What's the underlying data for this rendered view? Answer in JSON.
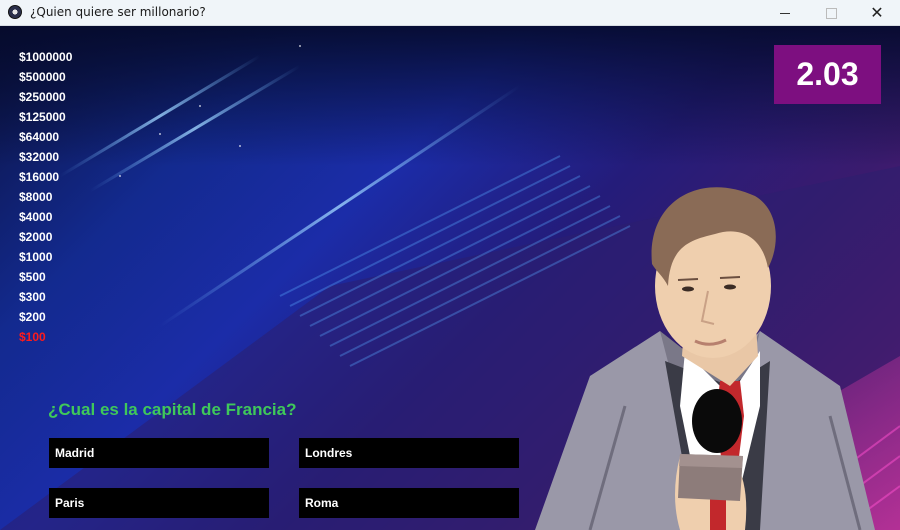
{
  "window": {
    "title": "¿Quien quiere ser millonario?",
    "minimize_icon": "minimize-icon",
    "maximize_icon": "maximize-icon",
    "close_icon": "close-icon"
  },
  "ladder": {
    "amounts": [
      "$1000000",
      "$500000",
      "$250000",
      "$125000",
      "$64000",
      "$32000",
      "$16000",
      "$8000",
      "$4000",
      "$2000",
      "$1000",
      "$500",
      "$300",
      "$200",
      "$100"
    ],
    "current_index": 14,
    "current_color": "#ff1b1b"
  },
  "timer": {
    "value": "2.03",
    "background": "#7d0f80"
  },
  "question": {
    "text": "¿Cual es la capital de Francia?",
    "color": "#3fc85a"
  },
  "answers": [
    {
      "label": "Madrid"
    },
    {
      "label": "Londres"
    },
    {
      "label": "Paris"
    },
    {
      "label": "Roma"
    }
  ],
  "host": {
    "icon": "host-with-microphone-icon"
  }
}
